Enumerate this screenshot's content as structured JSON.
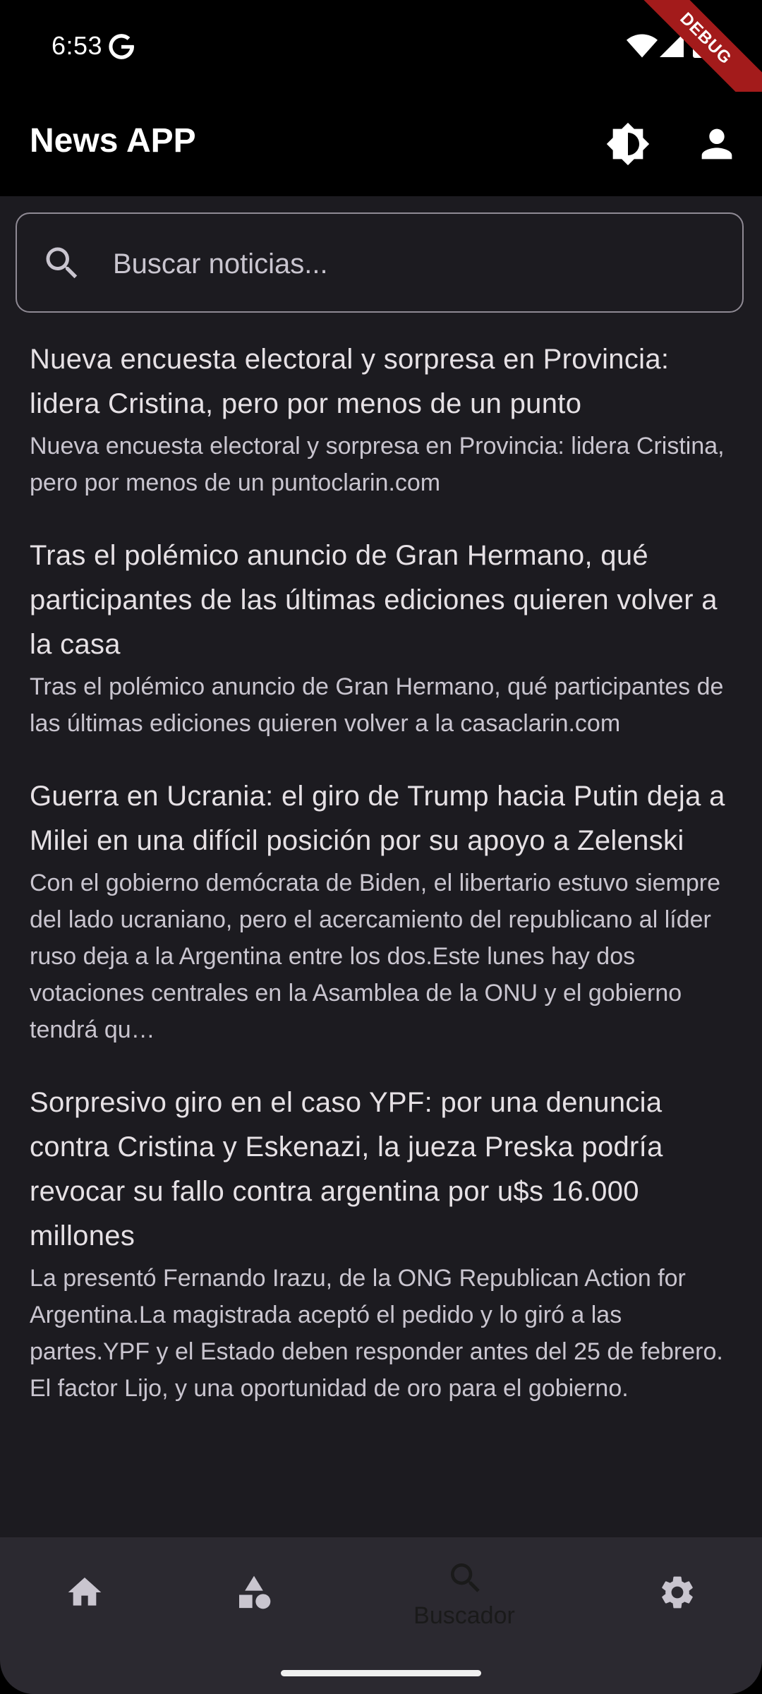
{
  "status_bar": {
    "time": "6:53",
    "debug_banner": "DEBUG"
  },
  "app_bar": {
    "title": "News APP",
    "theme_icon": "brightness-icon",
    "profile_icon": "person-icon"
  },
  "search": {
    "placeholder": "Buscar noticias...",
    "value": ""
  },
  "articles": [
    {
      "title": "Nueva encuesta electoral y sorpresa en Provincia: lidera Cristina, pero por menos de un punto",
      "description": "Nueva encuesta electoral y sorpresa en Provincia: lidera Cristina, pero por menos de un puntoclarin.com"
    },
    {
      "title": "Tras el polémico anuncio de Gran Hermano, qué participantes de las últimas ediciones quieren volver a la casa",
      "description": "Tras el polémico anuncio de Gran Hermano, qué participantes de las últimas ediciones quieren volver a la casaclarin.com"
    },
    {
      "title": "Guerra en Ucrania: el giro de Trump hacia Putin deja a Milei en una difícil posición por su apoyo a Zelenski",
      "description": "Con el gobierno demócrata de Biden, el libertario estuvo siempre del lado ucraniano, pero el acercamiento del republicano al líder ruso deja a la Argentina entre los dos.Este lunes hay dos votaciones centrales en la Asamblea de la ONU  y el gobierno tendrá qu…"
    },
    {
      "title": "Sorpresivo giro en el caso YPF: por una denuncia contra Cristina y Eskenazi, la jueza Preska podría revocar su fallo contra argentina por u$s 16.000 millones",
      "description": "La presentó Fernando Irazu, de la ONG Republican Action for Argentina.La magistrada aceptó el pedido y lo giró a las partes.YPF y el Estado deben responder antes del 25 de febrero. El factor Lijo, y una oportunidad de oro para el gobierno."
    }
  ],
  "bottom_nav": {
    "items": [
      {
        "icon": "home-icon",
        "label": ""
      },
      {
        "icon": "category-icon",
        "label": ""
      },
      {
        "icon": "search-icon",
        "label": "Buscador",
        "selected": true
      },
      {
        "icon": "settings-icon",
        "label": ""
      }
    ]
  },
  "colors": {
    "background": "#1c1b20",
    "app_bar": "#000000",
    "nav_bar": "#2b2930",
    "debug_banner": "#a31b1b"
  }
}
